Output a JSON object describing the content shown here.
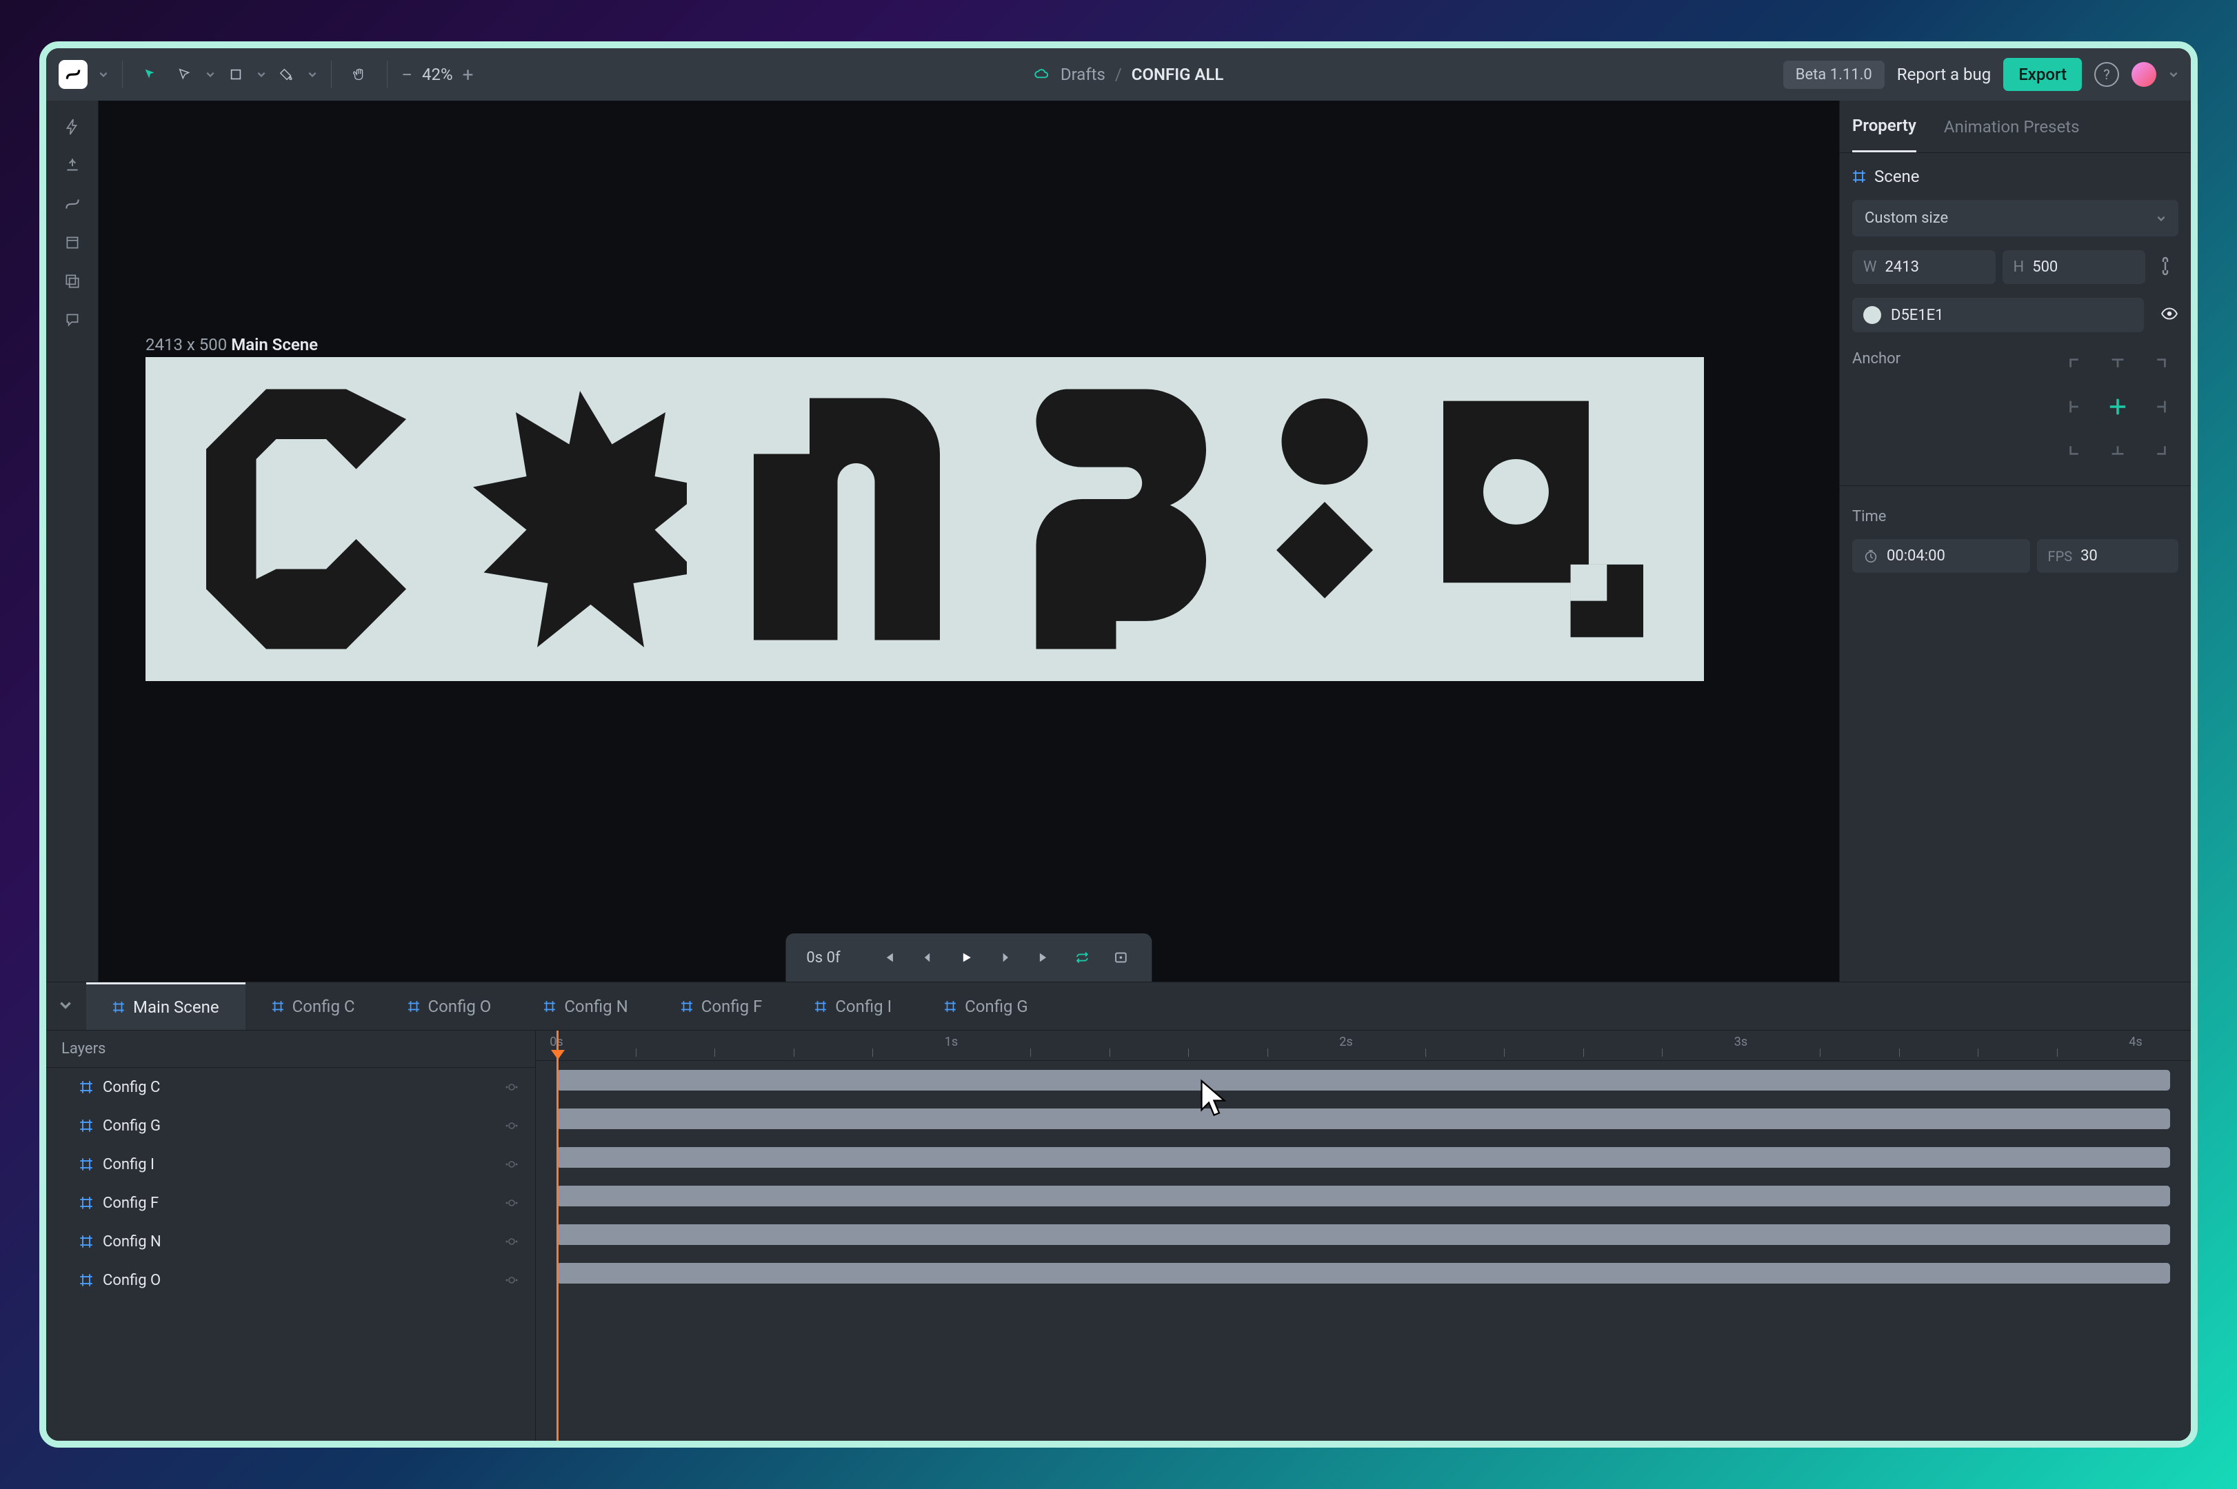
{
  "toolbar": {
    "zoom": "42%",
    "breadcrumb_parent": "Drafts",
    "breadcrumb_sep": "/",
    "doc_name": "CONFIG ALL",
    "beta_label": "Beta 1.11.0",
    "report_bug": "Report a bug",
    "export": "Export"
  },
  "canvas": {
    "scene_dims": "2413 x 500",
    "scene_name": "Main Scene"
  },
  "playback": {
    "time_text": "0s 0f"
  },
  "panel": {
    "tabs": {
      "property": "Property",
      "presets": "Animation Presets"
    },
    "scene_label": "Scene",
    "size_mode": "Custom size",
    "width_label": "W",
    "width_value": "2413",
    "height_label": "H",
    "height_value": "500",
    "color_hex": "D5E1E1",
    "anchor_label": "Anchor",
    "time_section": "Time",
    "time_value": "00:04:00",
    "fps_label": "FPS",
    "fps_value": "30"
  },
  "timeline": {
    "tabs": [
      "Main Scene",
      "Config C",
      "Config O",
      "Config N",
      "Config F",
      "Config I",
      "Config G"
    ],
    "layers_header": "Layers",
    "layers": [
      "Config C",
      "Config G",
      "Config I",
      "Config F",
      "Config N",
      "Config O"
    ],
    "ruler": [
      "0s",
      "1s",
      "2s",
      "3s",
      "4s"
    ]
  }
}
